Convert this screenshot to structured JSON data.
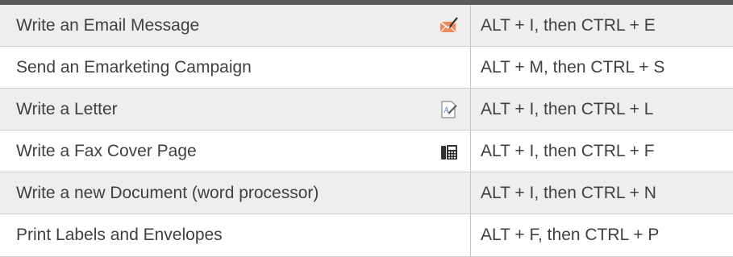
{
  "rows": [
    {
      "action": "Write an Email Message",
      "shortcut": "ALT + I, then CTRL + E",
      "icon": "email-icon"
    },
    {
      "action": "Send an Emarketing Campaign",
      "shortcut": "ALT + M, then CTRL + S",
      "icon": ""
    },
    {
      "action": "Write a Letter",
      "shortcut": "ALT + I, then CTRL + L",
      "icon": "letter-icon"
    },
    {
      "action": "Write a Fax Cover Page",
      "shortcut": "ALT + I, then CTRL + F",
      "icon": "fax-icon"
    },
    {
      "action": "Write a new Document (word processor)",
      "shortcut": "ALT + I, then CTRL + N",
      "icon": ""
    },
    {
      "action": "Print Labels and Envelopes",
      "shortcut": "ALT + F, then CTRL + P",
      "icon": ""
    }
  ],
  "colors": {
    "header_bar": "#595959",
    "row_shaded": "#eeeeee",
    "text": "#404040",
    "email_icon": "#e8764a"
  }
}
